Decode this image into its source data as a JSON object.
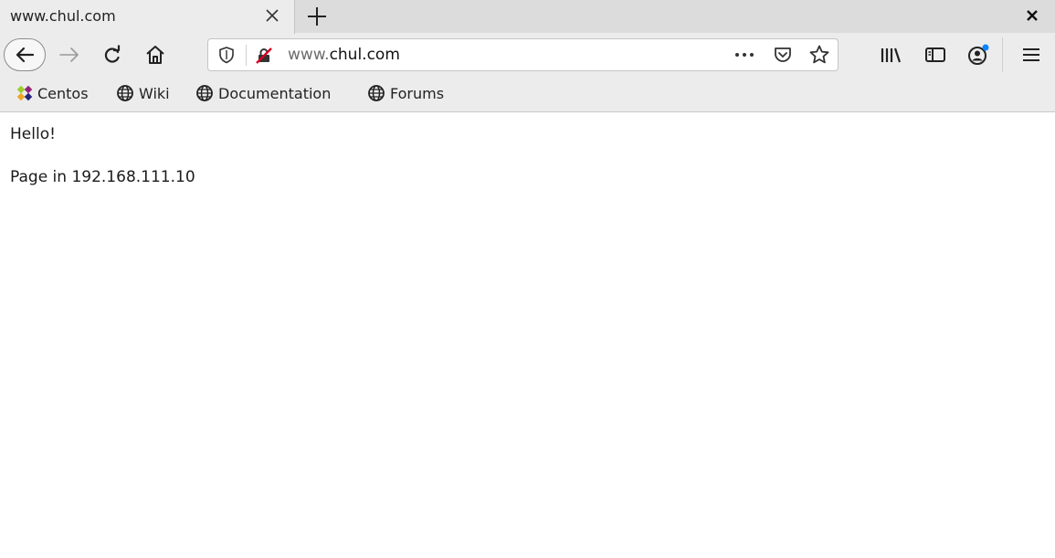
{
  "tab": {
    "title": "www.chul.com"
  },
  "urlbar": {
    "url_prefix": "www.",
    "url_domain": "chul.com"
  },
  "bookmarks": [
    {
      "label": "Centos",
      "icon": "centos-icon"
    },
    {
      "label": "Wiki",
      "icon": "globe-icon"
    },
    {
      "label": "Documentation",
      "icon": "globe-icon"
    },
    {
      "label": "Forums",
      "icon": "globe-icon"
    }
  ],
  "content": {
    "line1": "Hello!",
    "line2": "Page in 192.168.111.10"
  },
  "colors": {
    "chrome_bg": "#ececec",
    "tab_strip_bg": "#dcdcdc",
    "notification_dot": "#0a84ff",
    "insecure_slash": "#d70022"
  }
}
